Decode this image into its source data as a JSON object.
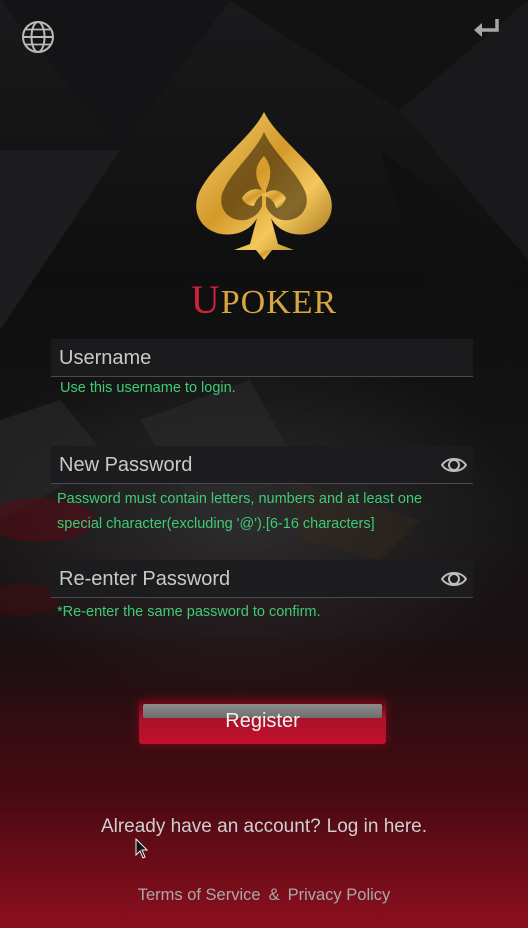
{
  "brand": {
    "first_letter": "U",
    "rest": "POKER"
  },
  "username": {
    "placeholder": "Username",
    "hint": "Use this username to login."
  },
  "new_password": {
    "placeholder": "New Password",
    "hint_line1": "Password must contain letters, numbers and at least one",
    "hint_line2": "special character(excluding '@').[6-16 characters]"
  },
  "reenter_password": {
    "placeholder": "Re-enter Password",
    "hint": "*Re-enter the same password to confirm."
  },
  "register_button": {
    "label": "Register"
  },
  "login_prompt": {
    "question": "Already have an account?",
    "link": "Log in here."
  },
  "footer": {
    "terms": "Terms of Service",
    "ampersand": "&",
    "privacy": "Privacy Policy"
  },
  "icons": {
    "top_left": "globe-icon",
    "top_right": "back-arrow-icon",
    "password_toggle": "eye-icon"
  },
  "colors": {
    "hint_green": "#3fcb74",
    "brand_red": "#d0213b",
    "brand_gold": "#d8a640",
    "button_red": "#c4102c"
  }
}
